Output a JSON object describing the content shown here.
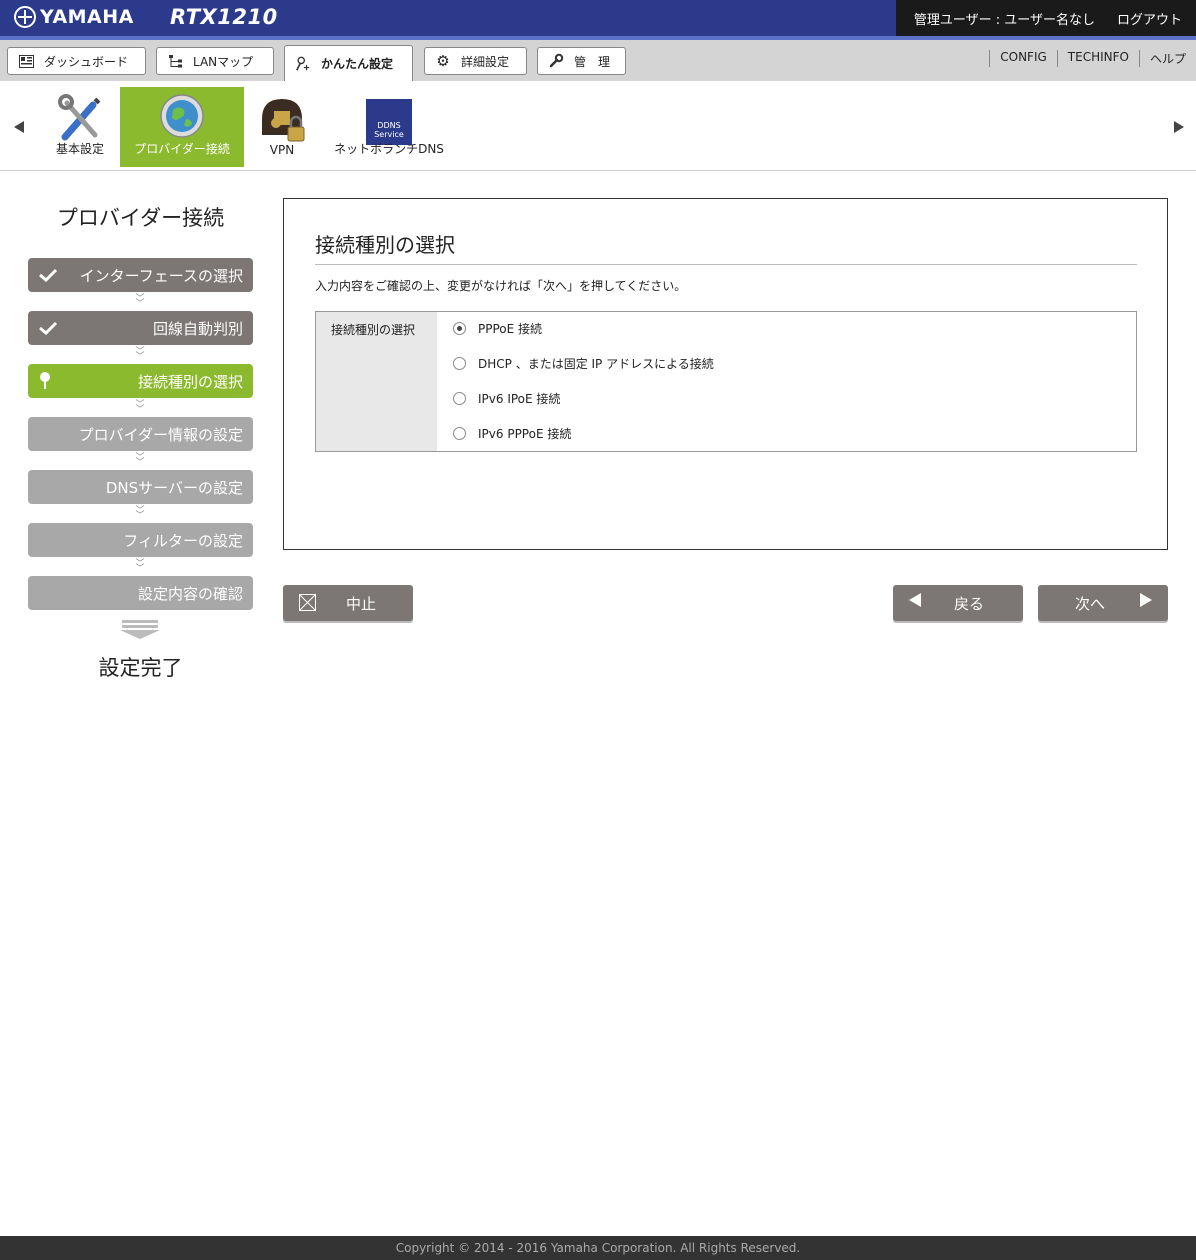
{
  "header": {
    "brand": "YAMAHA",
    "model": "RTX1210",
    "user_label": "管理ユーザー : ユーザー名なし",
    "logout": "ログアウト"
  },
  "tabs": [
    {
      "label": "ダッシュボード",
      "icon": "dashboard-icon"
    },
    {
      "label": "LANマップ",
      "icon": "lan-map-icon"
    },
    {
      "label": "かんたん設定",
      "icon": "wizard-icon"
    },
    {
      "label": "詳細設定",
      "icon": "gear-icon"
    },
    {
      "label": "管　理",
      "icon": "wrench-icon"
    }
  ],
  "toplinks": [
    "CONFIG",
    "TECHINFO",
    "ヘルプ"
  ],
  "subnav": [
    {
      "label": "基本設定",
      "icon": "tools-icon"
    },
    {
      "label": "プロバイダー接続",
      "icon": "globe-icon"
    },
    {
      "label": "VPN",
      "icon": "vpn-lock-icon"
    },
    {
      "label": "ネットボランチDNS",
      "icon": "ddns-service-icon",
      "logo_text": "DDNS Service"
    }
  ],
  "sidebar": {
    "title": "プロバイダー接続",
    "steps": [
      {
        "label": "インターフェースの選択",
        "state": "done"
      },
      {
        "label": "回線自動判別",
        "state": "done"
      },
      {
        "label": "接続種別の選択",
        "state": "current"
      },
      {
        "label": "プロバイダー情報の設定",
        "state": "pending"
      },
      {
        "label": "DNSサーバーの設定",
        "state": "pending"
      },
      {
        "label": "フィルターの設定",
        "state": "pending"
      },
      {
        "label": "設定内容の確認",
        "state": "pending"
      }
    ],
    "done_label": "設定完了"
  },
  "panel": {
    "title": "接続種別の選択",
    "description": "入力内容をご確認の上、変更がなければ「次へ」を押してください。",
    "field_label": "接続種別の選択",
    "options": [
      {
        "label": "PPPoE 接続",
        "selected": true
      },
      {
        "label": "DHCP 、または固定 IP アドレスによる接続",
        "selected": false
      },
      {
        "label": "IPv6 IPoE 接続",
        "selected": false
      },
      {
        "label": "IPv6 PPPoE 接続",
        "selected": false
      }
    ]
  },
  "buttons": {
    "cancel": "中止",
    "back": "戻る",
    "next": "次へ"
  },
  "footer": "Copyright © 2014 - 2016 Yamaha Corporation. All Rights Reserved.",
  "colors": {
    "header_blue": "#2c3a8c",
    "accent_green": "#8cba2e",
    "step_done": "#7c7775",
    "step_pending": "#a8a8a8"
  }
}
